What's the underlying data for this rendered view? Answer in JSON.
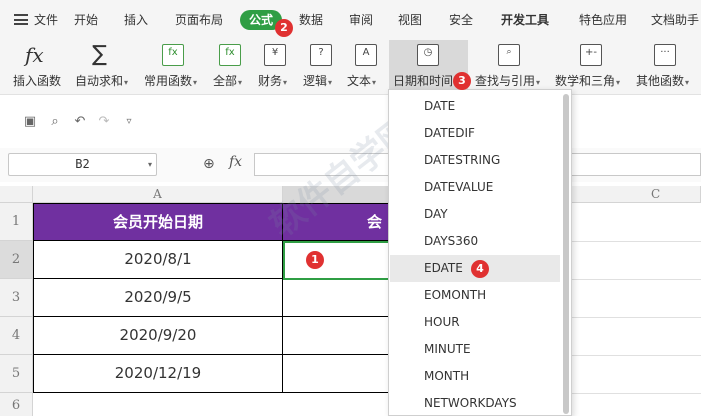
{
  "menu": {
    "file": "文件",
    "tabs": [
      "开始",
      "插入",
      "页面布局",
      "公式",
      "数据",
      "审阅",
      "视图",
      "安全",
      "开发工具",
      "特色应用",
      "文档助手"
    ]
  },
  "ribbon": {
    "buttons": [
      {
        "label": "插入函数",
        "icon": "fx"
      },
      {
        "label": "自动求和",
        "icon": "∑"
      },
      {
        "label": "常用函数",
        "icon": "fx"
      },
      {
        "label": "全部",
        "icon": "fx"
      },
      {
        "label": "财务",
        "icon": "¥"
      },
      {
        "label": "逻辑",
        "icon": "?"
      },
      {
        "label": "文本",
        "icon": "A"
      },
      {
        "label": "日期和时间",
        "icon": "◷"
      },
      {
        "label": "查找与引用",
        "icon": "🔍"
      },
      {
        "label": "数学和三角",
        "icon": "+-"
      },
      {
        "label": "其他函数",
        "icon": "···"
      }
    ]
  },
  "formula_bar": {
    "cell_ref": "B2",
    "fx": "fx",
    "formula": ""
  },
  "sheet": {
    "columns": [
      "A",
      "",
      "C"
    ],
    "rows": [
      "1",
      "2",
      "3",
      "4",
      "5",
      "6"
    ],
    "header_a": "会员开始日期",
    "header_b": "会员",
    "values_a": [
      "2020/8/1",
      "2020/9/5",
      "2020/9/20",
      "2020/12/19"
    ]
  },
  "dropdown": {
    "items": [
      "DATE",
      "DATEDIF",
      "DATESTRING",
      "DATEVALUE",
      "DAY",
      "DAYS360",
      "EDATE",
      "EOMONTH",
      "HOUR",
      "MINUTE",
      "MONTH",
      "NETWORKDAYS"
    ],
    "highlighted": "EDATE"
  },
  "badges": [
    "1",
    "2",
    "3",
    "4"
  ],
  "colors": {
    "accent": "#2f9e44",
    "header_fill": "#7030a0",
    "badge": "#e03131"
  }
}
